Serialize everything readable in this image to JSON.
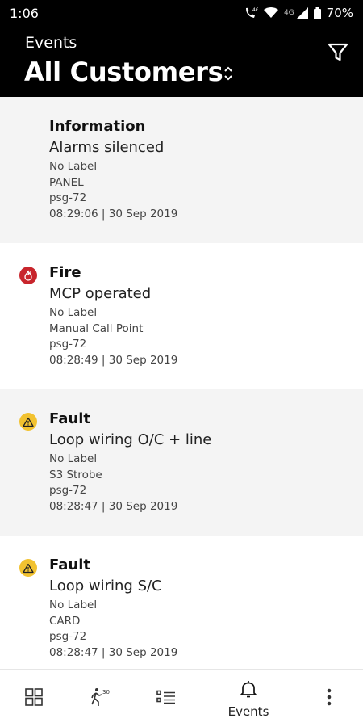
{
  "status_bar": {
    "time": "1:06",
    "network_small": "4G",
    "battery": "70%"
  },
  "header": {
    "subtitle": "Events",
    "title": "All Customers",
    "filter_icon": "filter-icon"
  },
  "events": [
    {
      "type": "Information",
      "icon": "none",
      "description": "Alarms silenced",
      "label": "No Label",
      "device": "PANEL",
      "panel": "psg-72",
      "timestamp": "08:29:06 | 30 Sep 2019"
    },
    {
      "type": "Fire",
      "icon": "fire-icon",
      "icon_color": "#c8252c",
      "description": "MCP operated",
      "label": "No Label",
      "device": "Manual Call Point",
      "panel": "psg-72",
      "timestamp": "08:28:49 | 30 Sep 2019"
    },
    {
      "type": "Fault",
      "icon": "warning-icon",
      "icon_color": "#f2c230",
      "description": "Loop wiring O/C + line",
      "label": "No Label",
      "device": "S3 Strobe",
      "panel": "psg-72",
      "timestamp": "08:28:47 | 30 Sep 2019"
    },
    {
      "type": "Fault",
      "icon": "warning-icon",
      "icon_color": "#f2c230",
      "description": "Loop wiring S/C",
      "label": "No Label",
      "device": "CARD",
      "panel": "psg-72",
      "timestamp": "08:28:47 | 30 Sep 2019"
    }
  ],
  "bottom_nav": {
    "items": [
      {
        "name": "dashboard",
        "icon": "grid-icon"
      },
      {
        "name": "walk-test",
        "icon": "walk-test-icon"
      },
      {
        "name": "list",
        "icon": "list-icon"
      },
      {
        "name": "events",
        "icon": "bell-icon",
        "label": "Events"
      },
      {
        "name": "more",
        "icon": "more-vertical-icon"
      }
    ]
  },
  "colors": {
    "header_bg": "#000000",
    "fire": "#c8252c",
    "fault": "#f2c230",
    "row_shaded": "#f4f4f4"
  }
}
